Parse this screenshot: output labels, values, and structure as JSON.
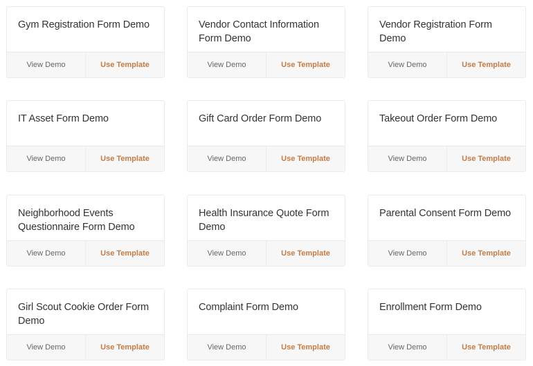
{
  "colors": {
    "accent": "#c27c46",
    "secondary_text": "#666666",
    "title_text": "#333333"
  },
  "labels": {
    "view_demo": "View Demo",
    "use_template": "Use Template"
  },
  "cards": [
    {
      "title": "Gym Registration Form Demo"
    },
    {
      "title": "Vendor Contact Information Form Demo"
    },
    {
      "title": "Vendor Registration Form Demo"
    },
    {
      "title": "IT Asset Form Demo"
    },
    {
      "title": "Gift Card Order Form Demo"
    },
    {
      "title": "Takeout Order Form Demo"
    },
    {
      "title": "Neighborhood Events Questionnaire Form Demo"
    },
    {
      "title": "Health Insurance Quote Form Demo"
    },
    {
      "title": "Parental Consent Form Demo"
    },
    {
      "title": "Girl Scout Cookie Order Form Demo"
    },
    {
      "title": "Complaint Form Demo"
    },
    {
      "title": "Enrollment Form Demo"
    }
  ]
}
